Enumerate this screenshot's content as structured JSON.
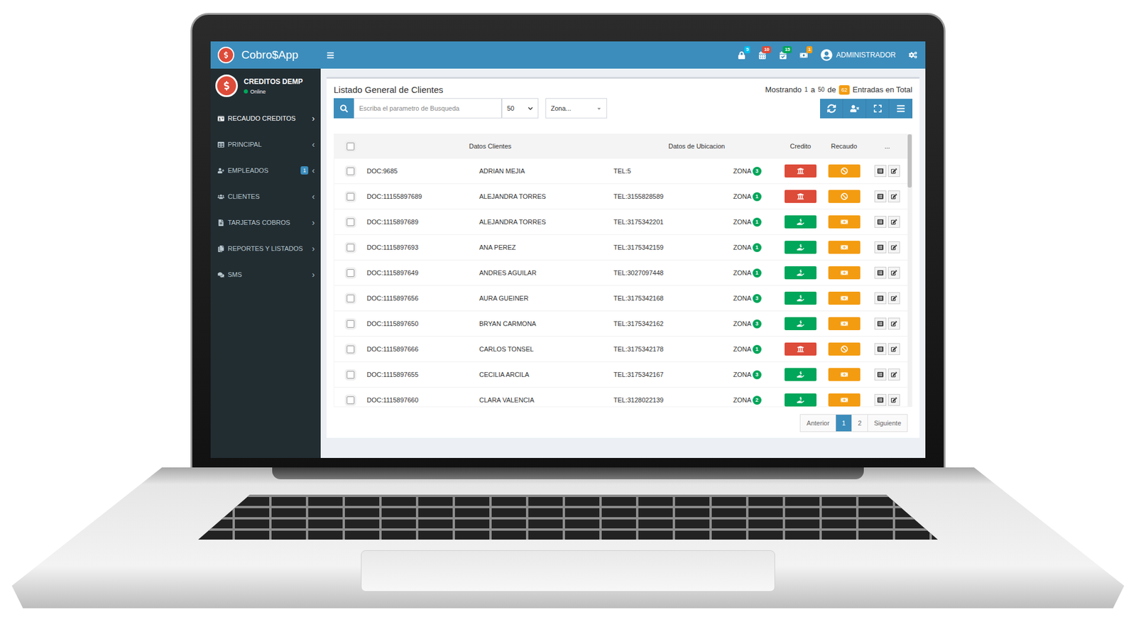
{
  "app": {
    "brand": "Cobro$App"
  },
  "header": {
    "notifications": [
      {
        "badge": "5",
        "color": "#00c0ef"
      },
      {
        "badge": "10",
        "color": "#dd4b39"
      },
      {
        "badge": "15",
        "color": "#00a65a"
      },
      {
        "badge": "1",
        "color": "#f39c12"
      }
    ],
    "user": "ADMINISTRADOR"
  },
  "sidebar": {
    "company": "CREDITOS DEMP",
    "status": "Online",
    "items": [
      {
        "label": "RECAUDO CREDITOS",
        "arrow": "›",
        "active": true,
        "badge": ""
      },
      {
        "label": "PRINCIPAL",
        "arrow": "‹",
        "active": false,
        "badge": ""
      },
      {
        "label": "EMPLEADOS",
        "arrow": "‹",
        "active": false,
        "badge": "1"
      },
      {
        "label": "CLIENTES",
        "arrow": "‹",
        "active": false,
        "badge": ""
      },
      {
        "label": "TARJETAS COBROS",
        "arrow": "›",
        "active": false,
        "badge": ""
      },
      {
        "label": "REPORTES Y LISTADOS",
        "arrow": "›",
        "active": false,
        "badge": ""
      },
      {
        "label": "SMS",
        "arrow": "›",
        "active": false,
        "badge": ""
      }
    ]
  },
  "content": {
    "title": "Listado General de Clientes",
    "showing": {
      "prefix": "Mostrando",
      "from": "1",
      "sep": "a",
      "to": "50",
      "of": "de",
      "total": "62",
      "suffix": "Entradas en Total"
    },
    "search": {
      "placeholder": "Escriba el parametro de Busqueda"
    },
    "page_size": "50",
    "zone_filter": "Zona..."
  },
  "table": {
    "columns": {
      "clients": "Datos Clientes",
      "location": "Datos de Ubicacion",
      "credit": "Credito",
      "collection": "Recaudo",
      "more": "..."
    },
    "zone_label": "ZONA",
    "rows": [
      {
        "doc": "DOC:9685",
        "name": "ADRIAN MEJIA",
        "tel": "TEL:5",
        "zone": "3",
        "credit_active": false,
        "checked": false
      },
      {
        "doc": "DOC:11155897689",
        "name": "ALEJANDRA TORRES",
        "tel": "TEL:3155828589",
        "zone": "1",
        "credit_active": false,
        "checked": false
      },
      {
        "doc": "DOC:1115897689",
        "name": "ALEJANDRA TORRES",
        "tel": "TEL:3175342201",
        "zone": "1",
        "credit_active": true,
        "checked": false
      },
      {
        "doc": "DOC:1115897693",
        "name": "ANA PEREZ",
        "tel": "TEL:3175342159",
        "zone": "1",
        "credit_active": true,
        "checked": false
      },
      {
        "doc": "DOC:1115897649",
        "name": "ANDRES AGUILAR",
        "tel": "TEL:3027097448",
        "zone": "1",
        "credit_active": true,
        "checked": false
      },
      {
        "doc": "DOC:1115897656",
        "name": "AURA GUEINER",
        "tel": "TEL:3175342168",
        "zone": "3",
        "credit_active": true,
        "checked": false
      },
      {
        "doc": "DOC:1115897650",
        "name": "BRYAN CARMONA",
        "tel": "TEL:3175342162",
        "zone": "3",
        "credit_active": true,
        "checked": false
      },
      {
        "doc": "DOC:1115897666",
        "name": "CARLOS TONSEL",
        "tel": "TEL:3175342178",
        "zone": "1",
        "credit_active": false,
        "checked": false
      },
      {
        "doc": "DOC:1115897655",
        "name": "CECILIA ARCILA",
        "tel": "TEL:3175342167",
        "zone": "3",
        "credit_active": true,
        "checked": false
      },
      {
        "doc": "DOC:1115897660",
        "name": "CLARA VALENCIA",
        "tel": "TEL:3128022139",
        "zone": "2",
        "credit_active": true,
        "checked": false
      }
    ]
  },
  "pagination": [
    {
      "label": "Anterior",
      "selected": false
    },
    {
      "label": "1",
      "selected": true
    },
    {
      "label": "2",
      "selected": false
    },
    {
      "label": "Siguiente",
      "selected": false
    }
  ]
}
